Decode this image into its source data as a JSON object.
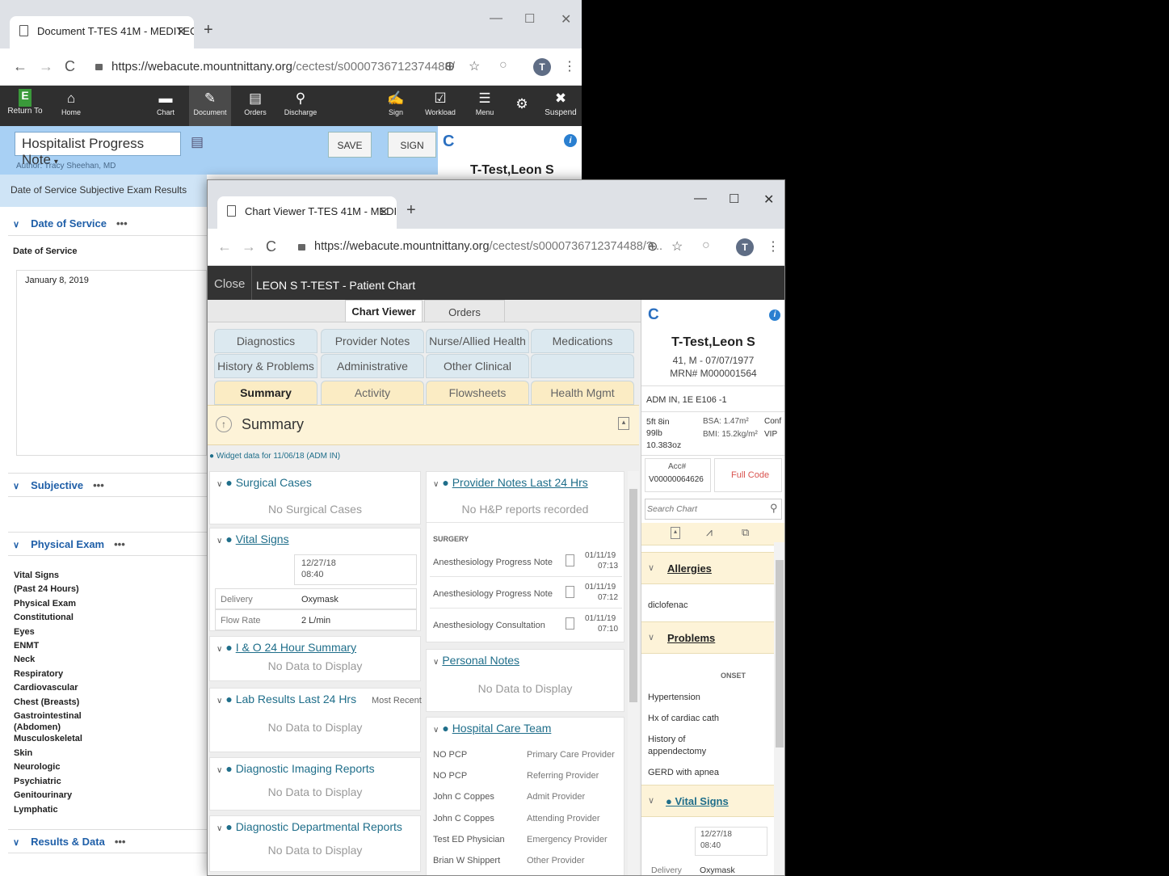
{
  "window1": {
    "tab_title": "Document T-TES 41M - MEDITEC",
    "url_main": "https://webacute.mountnittany.org",
    "url_path": "/cectest/s0000736712374488/",
    "toolbar": [
      {
        "icon": "E",
        "label": "Return To"
      },
      {
        "icon": "⌂",
        "label": "Home"
      },
      {
        "icon": "▬",
        "label": "Chart"
      },
      {
        "icon": "✎",
        "label": "Document"
      },
      {
        "icon": "▤",
        "label": "Orders"
      },
      {
        "icon": "⚲",
        "label": "Discharge"
      },
      {
        "icon": "✍",
        "label": "Sign"
      },
      {
        "icon": "☑",
        "label": "Workload"
      },
      {
        "icon": "☰",
        "label": "Menu"
      },
      {
        "icon": "⚙",
        "label": ""
      },
      {
        "icon": "✖",
        "label": "Suspend"
      }
    ],
    "note_title": "Hospitalist Progress Note",
    "author": "Author: Tracy Sheehan, MD",
    "save_label": "SAVE",
    "sign_label": "SIGN",
    "patient_name": "T-Test,Leon S",
    "section_tabs": "Date of Service   Subjective   Exam   Results",
    "date_of_service_header": "Date of Service",
    "date_of_service_label": "Date of Service",
    "date_value": "January 8, 2019",
    "subjective_header": "Subjective",
    "physical_exam_header": "Physical Exam",
    "exam_items": [
      "Vital Signs",
      "(Past 24 Hours)",
      "Physical Exam",
      "Constitutional",
      "Eyes",
      "ENMT",
      "Neck",
      "Respiratory",
      "Cardiovascular",
      "Chest (Breasts)",
      "Gastrointestinal",
      "(Abdomen)",
      "Musculoskeletal",
      "Skin",
      "Neurologic",
      "Psychiatric",
      "Genitourinary",
      "Lymphatic"
    ],
    "results_header": "Results & Data",
    "dots": "•••"
  },
  "window2": {
    "tab_title": "Chart Viewer T-TES 41M - MEDIT",
    "url_main": "https://webacute.mountnittany.org",
    "url_path": "/cectest/s0000736712374488/?...",
    "close_label": "Close",
    "chart_title": "LEON S T-TEST - Patient Chart",
    "top_tabs": [
      "Chart Viewer",
      "Orders"
    ],
    "tabs_row1": [
      "Diagnostics",
      "Provider Notes",
      "Nurse/Allied Health",
      "Medications"
    ],
    "tabs_row2": [
      "History & Problems",
      "Administrative",
      "Other Clinical"
    ],
    "tabs_row3": [
      "Summary",
      "Activity",
      "Flowsheets",
      "Health Mgmt"
    ],
    "summary_title": "Summary",
    "widget_data_note": "● Widget data for 11/06/18 (ADM IN)",
    "surgical_cases": {
      "title": "Surgical Cases",
      "empty": "No Surgical Cases"
    },
    "vital_signs": {
      "title": "Vital Signs",
      "date": "12/27/18",
      "time": "08:40",
      "rows": [
        {
          "label": "Delivery",
          "value": "Oxymask"
        },
        {
          "label": "Flow Rate",
          "value": "2 L/min"
        }
      ]
    },
    "io_summary": {
      "title": "I & O 24 Hour Summary",
      "empty": "No Data to Display"
    },
    "lab_results": {
      "title": "Lab Results Last 24 Hrs",
      "sub": "Most Recent",
      "empty": "No Data to Display"
    },
    "diag_imaging": {
      "title": "Diagnostic Imaging Reports",
      "empty": "No Data to Display"
    },
    "diag_dept": {
      "title": "Diagnostic Departmental Reports",
      "empty": "No Data to Display"
    },
    "provider_notes": {
      "title": "Provider Notes Last 24 Hrs",
      "empty": "No H&P reports recorded",
      "group": "SURGERY",
      "rows": [
        {
          "name": "Anesthesiology Progress Note",
          "date": "01/11/19",
          "time": "07:13"
        },
        {
          "name": "Anesthesiology Progress Note",
          "date": "01/11/19",
          "time": "07:12"
        },
        {
          "name": "Anesthesiology Consultation",
          "date": "01/11/19",
          "time": "07:10"
        }
      ]
    },
    "personal_notes": {
      "title": "Personal Notes",
      "empty": "No Data to Display"
    },
    "care_team": {
      "title": "Hospital Care Team",
      "rows": [
        {
          "name": "NO PCP",
          "role": "Primary Care Provider"
        },
        {
          "name": "NO PCP",
          "role": "Referring Provider"
        },
        {
          "name": "John C Coppes",
          "role": "Admit Provider"
        },
        {
          "name": "John C Coppes",
          "role": "Attending Provider"
        },
        {
          "name": "Test ED Physician",
          "role": "Emergency Provider"
        },
        {
          "name": "Brian W Shippert",
          "role": "Other Provider"
        }
      ]
    },
    "sidebar": {
      "patient_name": "T-Test,Leon S",
      "demographics": "41, M - 07/07/1977",
      "mrn": "MRN# M000001564",
      "location": "ADM IN, 1E  E106 -1",
      "height": "5ft 8in",
      "weight": "99lb",
      "weight2": "10.383oz",
      "bsa": "BSA: 1.47m²",
      "bmi": "BMI: 15.2kg/m²",
      "conf": "Conf",
      "vip": "VIP",
      "acc_label": "Acc#",
      "acc_value": "V00000064626",
      "code_status": "Full Code",
      "search_placeholder": "Search Chart",
      "allergies_title": "Allergies",
      "allergy": "diclofenac",
      "problems_title": "Problems",
      "onset_label": "ONSET",
      "problems": [
        "Hypertension",
        "Hx of cardiac cath",
        "History of",
        "appendectomy",
        "GERD with apnea"
      ],
      "vitals_title": "Vital Signs",
      "vitals_date": "12/27/18",
      "vitals_time": "08:40",
      "vitals_delivery_label": "Delivery",
      "vitals_delivery_value": "Oxymask"
    }
  },
  "colors": {
    "accent": "#1f6e8a",
    "tab_active": "#fbecc4",
    "toolbar": "#2f2f2f",
    "code_red": "#d9534f"
  }
}
